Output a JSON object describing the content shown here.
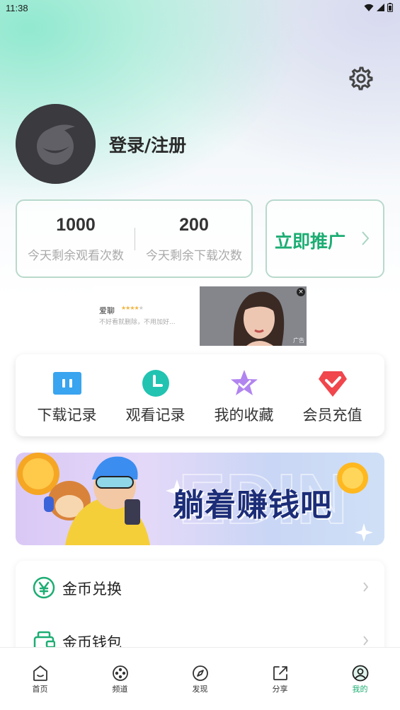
{
  "status_bar": {
    "time": "11:38"
  },
  "profile": {
    "login_label": "登录/注册"
  },
  "stats": [
    {
      "value": "1000",
      "label": "今天剩余观看次数"
    },
    {
      "value": "200",
      "label": "今天剩余下载次数"
    }
  ],
  "promo": {
    "label": "立即推广"
  },
  "ad": {
    "name": "爱聊",
    "rating_stars": 4,
    "description": "不好看就删除，不用加好...",
    "tag": "广告"
  },
  "quick_actions": [
    {
      "label": "下载记录",
      "icon": "download-history-icon"
    },
    {
      "label": "观看记录",
      "icon": "clock-icon"
    },
    {
      "label": "我的收藏",
      "icon": "star-icon"
    },
    {
      "label": "会员充值",
      "icon": "diamond-icon"
    }
  ],
  "banner": {
    "text": "躺着赚钱吧"
  },
  "menu": [
    {
      "label": "金币兑换",
      "icon": "yen-coin-icon"
    },
    {
      "label": "金币钱包",
      "icon": "wallet-icon"
    }
  ],
  "tabs": [
    {
      "label": "首页",
      "icon": "home-icon"
    },
    {
      "label": "频道",
      "icon": "film-reel-icon"
    },
    {
      "label": "发现",
      "icon": "compass-icon"
    },
    {
      "label": "分享",
      "icon": "share-icon"
    },
    {
      "label": "我的",
      "icon": "profile-icon",
      "active": true
    }
  ],
  "colors": {
    "accent_green": "#1cad73",
    "card_border": "#b8d9cb",
    "banner_text": "#1c2d78"
  }
}
